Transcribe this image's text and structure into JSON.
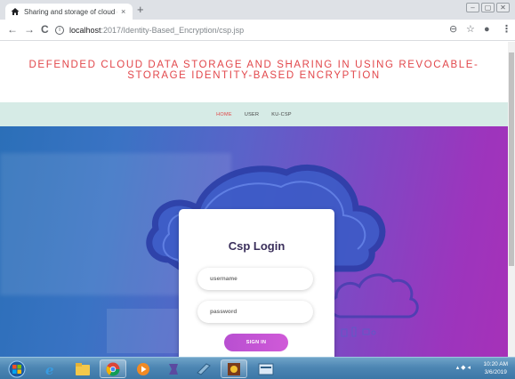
{
  "browser": {
    "tab_title": "Sharing and storage of cloud da",
    "close_glyph": "×",
    "newtab_glyph": "+",
    "back_glyph": "←",
    "forward_glyph": "→",
    "reload_glyph": "C",
    "url_host": "localhost",
    "url_rest": ":2017/Identity-Based_Encryption/csp.jsp",
    "zoom_glyph": "⊖",
    "star_glyph": "☆",
    "profile_glyph": "●",
    "menu_glyph": "⋮",
    "window_controls": [
      "–",
      "▢",
      "✕"
    ]
  },
  "page": {
    "heading_line1": "DEFENDED CLOUD DATA STORAGE AND SHARING IN USING REVOCABLE-",
    "heading_line2": "STORAGE IDENTITY-BASED ENCRYPTION",
    "nav": [
      {
        "label": "HOME",
        "active": true
      },
      {
        "label": "USER",
        "active": false
      },
      {
        "label": "KU-CSP",
        "active": false
      }
    ],
    "login": {
      "title": "Csp Login",
      "username_placeholder": "username",
      "password_placeholder": "password",
      "submit_label": "SIGN IN"
    }
  },
  "taskbar": {
    "time": "10:20 AM",
    "date": "3/6/2019"
  },
  "colors": {
    "heading": "#e2474b",
    "nav_bg": "#d6ebe6",
    "button": "#c052d4",
    "card_title": "#3a2f5b"
  }
}
